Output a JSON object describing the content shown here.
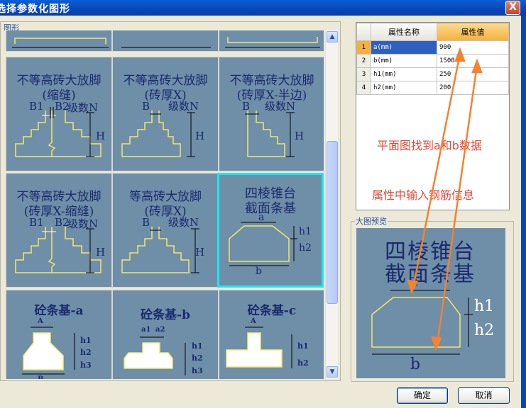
{
  "window": {
    "title": "选择参数化图形",
    "close_glyph": "X"
  },
  "gallery": {
    "group_label": "图形",
    "tiles": [
      {
        "label": "",
        "lines": []
      },
      {
        "label": "",
        "lines": []
      },
      {
        "label": "",
        "lines": []
      },
      {
        "lines": [
          "不等高砖大放脚",
          "(缩缝)"
        ],
        "dims": {
          "left": "B1",
          "right": "B2",
          "n": "级数N",
          "h": "H"
        }
      },
      {
        "lines": [
          "不等高砖大放脚",
          "(砖厚X)"
        ],
        "dims": {
          "left": "B",
          "n": "级数N",
          "h": "H"
        }
      },
      {
        "lines": [
          "不等高砖大放脚",
          "(砖厚X-半边)"
        ],
        "dims": {
          "left": "B",
          "n": "级数N",
          "h": "H"
        }
      },
      {
        "lines": [
          "不等高砖大放脚",
          "(砖厚X-缩缝)"
        ],
        "dims": {
          "left": "B1",
          "right": "B2",
          "n": "级数N",
          "h": "H"
        }
      },
      {
        "lines": [
          "等高砖大放脚",
          "(砖厚X)"
        ],
        "dims": {
          "left": "B",
          "n": "级数N",
          "h": "H"
        }
      },
      {
        "lines": [
          "四棱锥台",
          "截面条基"
        ],
        "dims": {
          "a": "a",
          "h1": "h1",
          "h2": "h2",
          "b": "b"
        }
      },
      {
        "lines": [
          "砼条基-a"
        ],
        "dims": {
          "a": "A",
          "h1": "h1",
          "h2": "h2",
          "h3": "h3",
          "b": "B"
        }
      },
      {
        "lines": [
          "砼条基-b"
        ],
        "dims": {
          "a1": "a1",
          "a2": "a2",
          "h1": "h1",
          "h2": "h2",
          "h3": "h3"
        }
      },
      {
        "lines": [
          "砼条基-c"
        ],
        "dims": {
          "a": "A",
          "h1": "h1",
          "h2": "h2"
        }
      }
    ]
  },
  "scrollbar": {
    "up_glyph": "▲",
    "down_glyph": "▼"
  },
  "properties": {
    "col_name": "属性名称",
    "col_value": "属性值",
    "rows": [
      {
        "num": "1",
        "name": "a(mm)",
        "value": "900"
      },
      {
        "num": "2",
        "name": "b(mm)",
        "value": "1500"
      },
      {
        "num": "3",
        "name": "h1(mm)",
        "value": "250"
      },
      {
        "num": "4",
        "name": "h2(mm)",
        "value": "200"
      }
    ],
    "annotation_1": "平面图找到a和b数据",
    "annotation_2": "属性中输入钢筋信息"
  },
  "preview": {
    "label": "大图预览",
    "title_line1": "四棱锥台",
    "title_line2": "截面条基",
    "a": "a",
    "b": "b",
    "h1": "h1",
    "h2": "h2"
  },
  "buttons": {
    "ok": "确定",
    "cancel": "取消"
  },
  "colors": {
    "tile_bg": "#6f8ea8",
    "selected_border": "#1ee6f0",
    "shape_line": "#f0e86a",
    "annotation": "#e54a39",
    "arrow": "#f4822e"
  }
}
